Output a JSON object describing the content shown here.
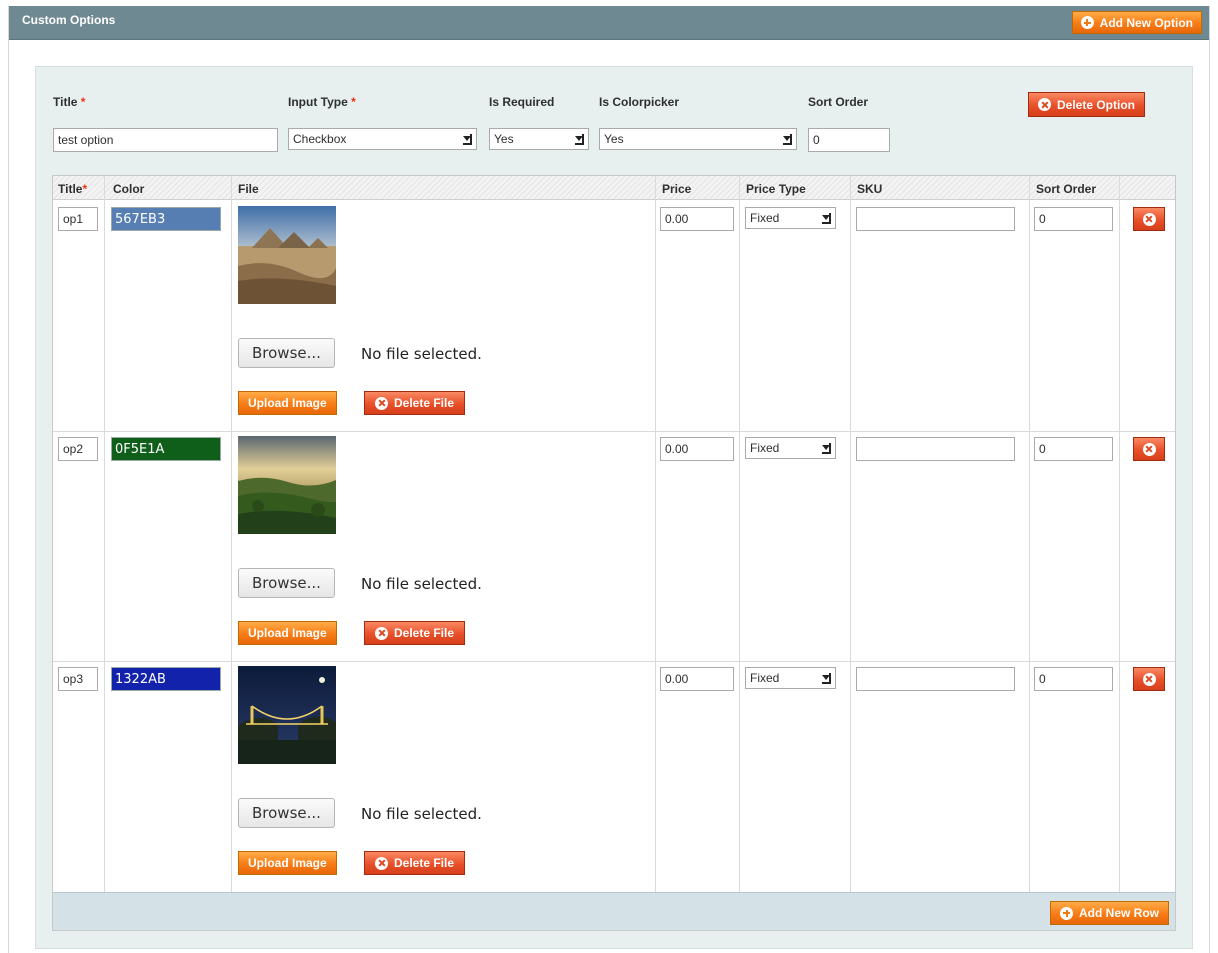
{
  "section": {
    "title": "Custom Options",
    "add_option_label": "Add New Option"
  },
  "option": {
    "labels": {
      "title": "Title",
      "input_type": "Input Type",
      "is_required": "Is Required",
      "is_colorpicker": "Is Colorpicker",
      "sort_order": "Sort Order",
      "required_marker": "*"
    },
    "values": {
      "title": "test option",
      "input_type": "Checkbox",
      "is_required": "Yes",
      "is_colorpicker": "Yes",
      "sort_order": "0"
    },
    "delete_label": "Delete Option"
  },
  "grid": {
    "headers": {
      "title": "Title",
      "color": "Color",
      "file": "File",
      "price": "Price",
      "price_type": "Price Type",
      "sku": "SKU",
      "sort_order": "Sort Order"
    },
    "browse_label": "Browse...",
    "no_file_label": "No file selected.",
    "upload_label": "Upload Image",
    "delete_file_label": "Delete File",
    "add_row_label": "Add New Row",
    "rows": [
      {
        "title": "op1",
        "color": "567EB3",
        "color_hex": "#567EB3",
        "price": "0.00",
        "price_type": "Fixed",
        "sku": "",
        "sort_order": "0",
        "thumb": "pyramids"
      },
      {
        "title": "op2",
        "color": "0F5E1A",
        "color_hex": "#0F5E1A",
        "price": "0.00",
        "price_type": "Fixed",
        "sku": "",
        "sort_order": "0",
        "thumb": "valley"
      },
      {
        "title": "op3",
        "color": "1322AB",
        "color_hex": "#1322AB",
        "price": "0.00",
        "price_type": "Fixed",
        "sku": "",
        "sort_order": "0",
        "thumb": "bridge-night"
      }
    ]
  },
  "colors": {
    "header_bar": "#6f8992",
    "button_orange": "#f77c16",
    "button_red": "#e8502a",
    "panel": "#e7efef"
  }
}
